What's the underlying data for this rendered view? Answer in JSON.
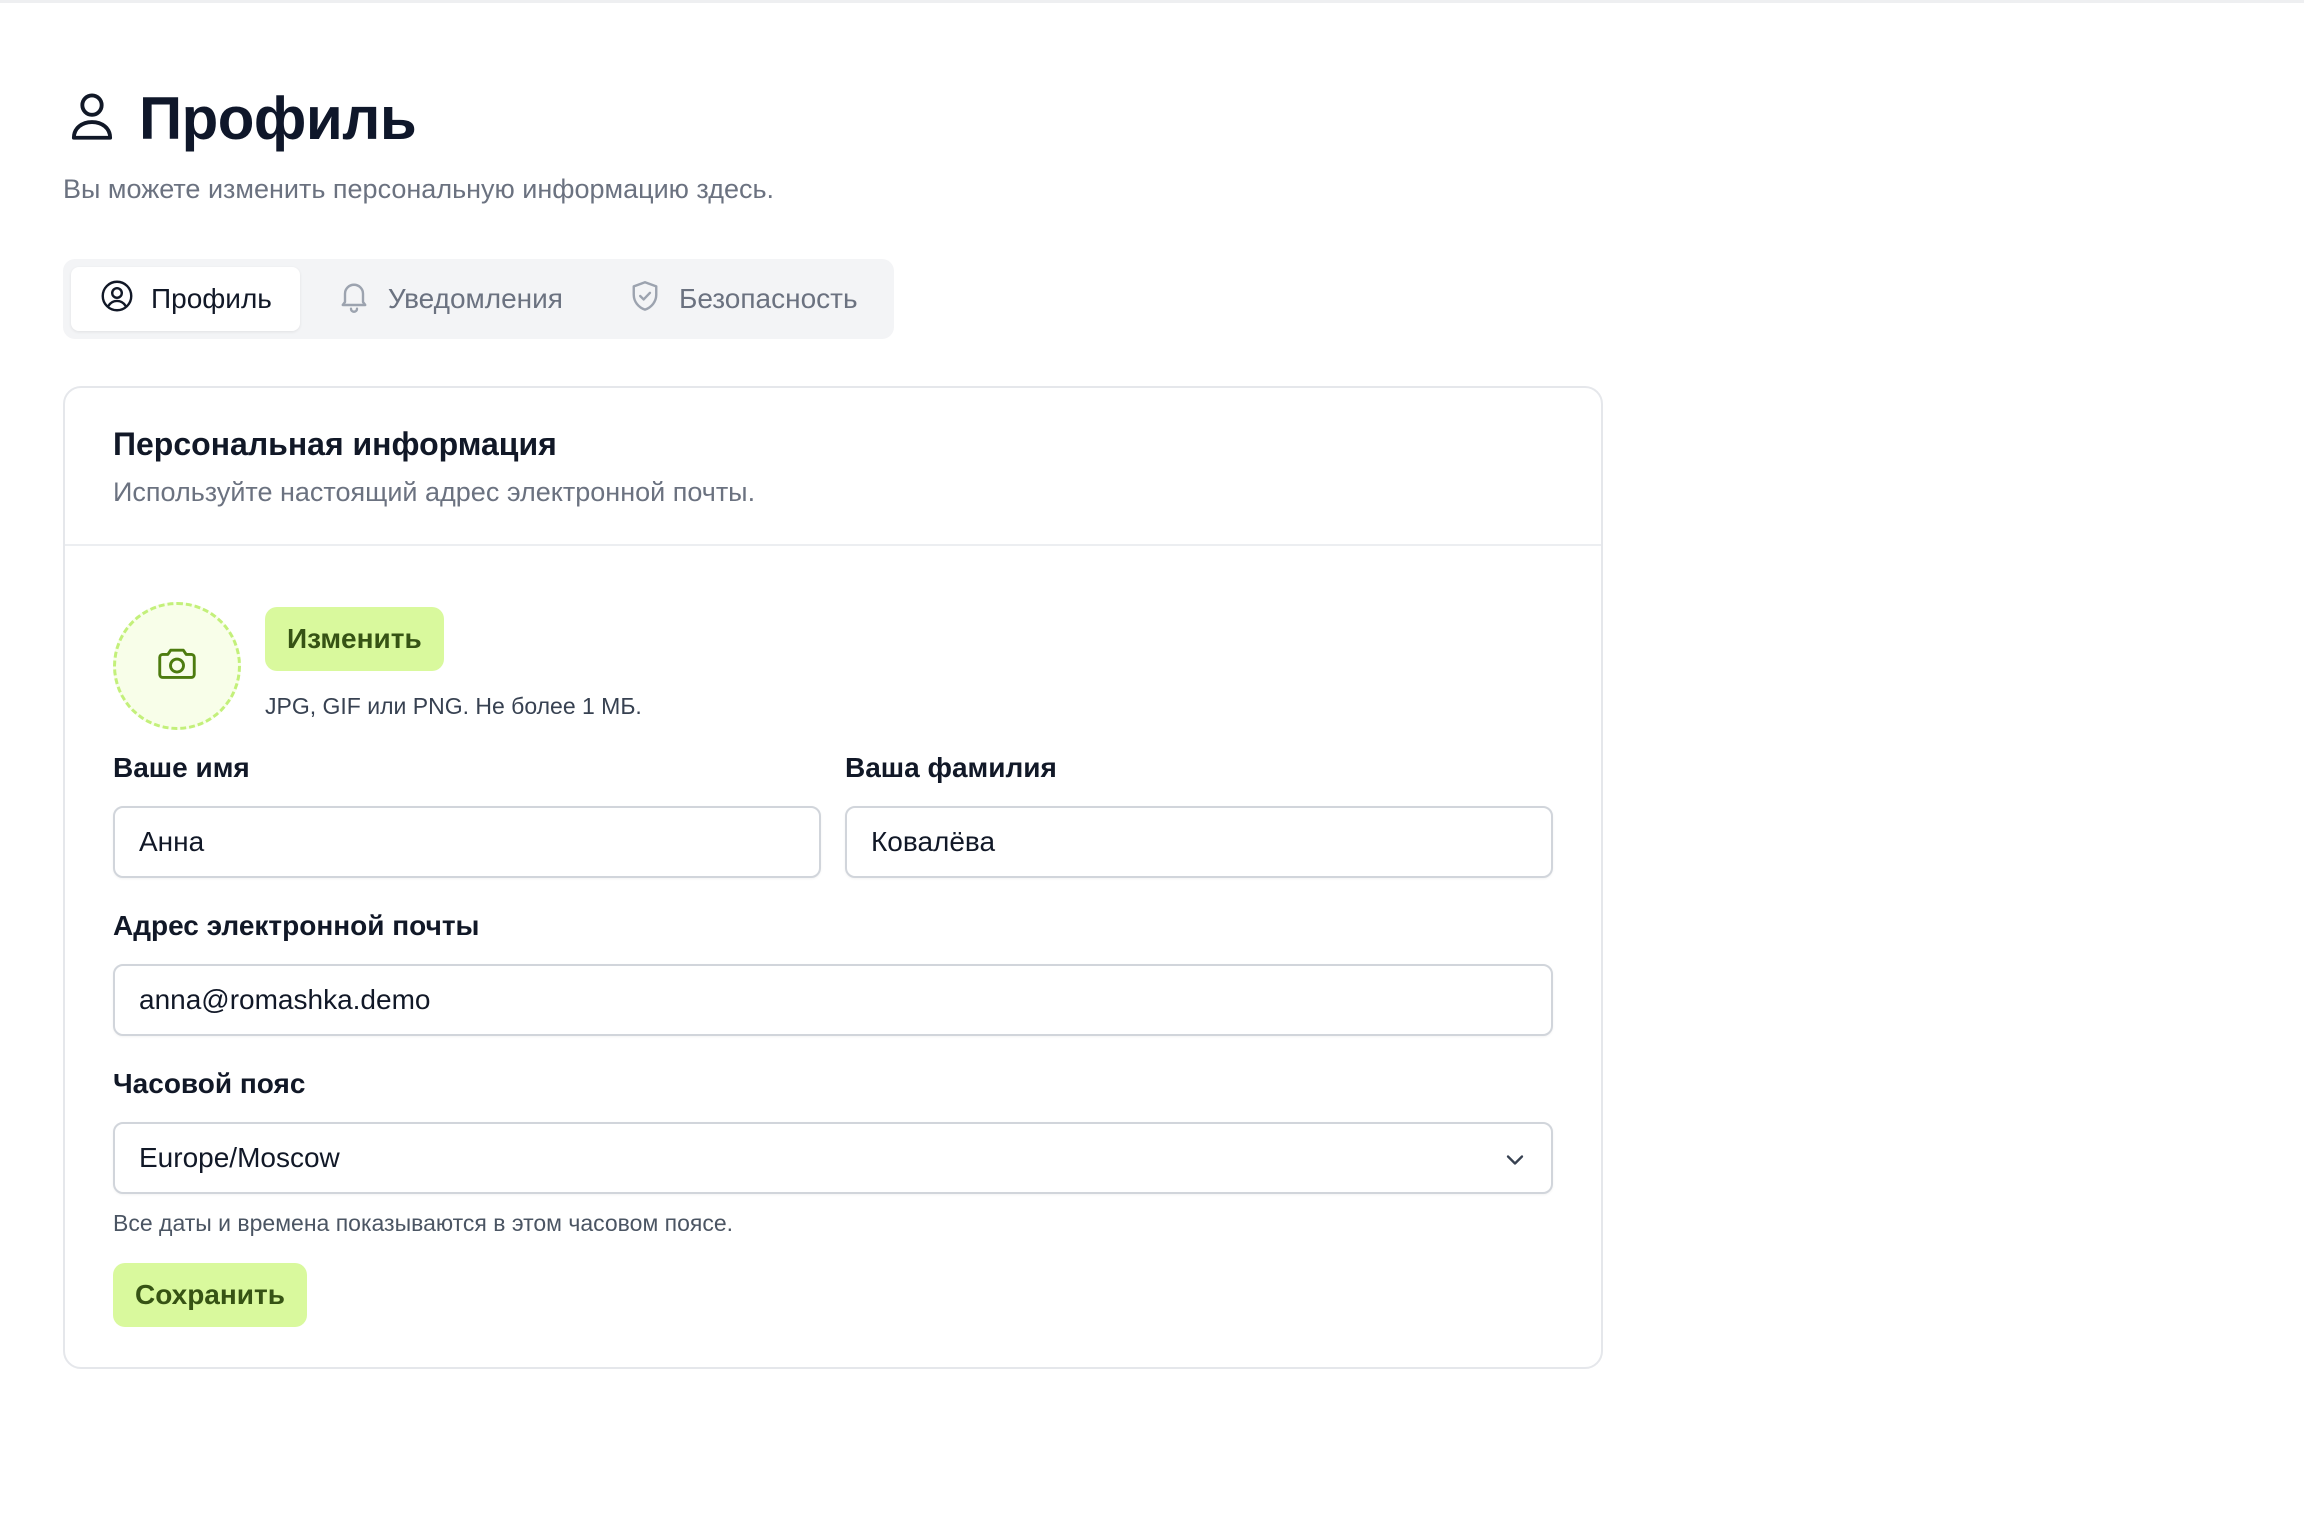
{
  "page": {
    "title": "Профиль",
    "subtitle": "Вы можете изменить персональную информацию здесь."
  },
  "tabs": [
    {
      "label": "Профиль",
      "icon": "user-circle-icon",
      "active": true
    },
    {
      "label": "Уведомления",
      "icon": "bell-icon",
      "active": false
    },
    {
      "label": "Безопасность",
      "icon": "shield-check-icon",
      "active": false
    }
  ],
  "card": {
    "title": "Персональная информация",
    "description": "Используйте настоящий адрес электронной почты."
  },
  "avatar": {
    "icon": "camera-icon",
    "change_label": "Изменить",
    "hint": "JPG, GIF или PNG. Не более 1 МБ."
  },
  "form": {
    "first_name": {
      "label": "Ваше имя",
      "value": "Анна"
    },
    "last_name": {
      "label": "Ваша фамилия",
      "value": "Ковалёва"
    },
    "email": {
      "label": "Адрес электронной почты",
      "value": "anna@romashka.demo"
    },
    "timezone": {
      "label": "Часовой пояс",
      "value": "Europe/Moscow",
      "hint": "Все даты и времена показываются в этом часовом поясе."
    },
    "save_label": "Сохранить"
  },
  "colors": {
    "accent": "#d9f99d",
    "accent_text": "#365314",
    "muted_text": "#6b7280"
  }
}
